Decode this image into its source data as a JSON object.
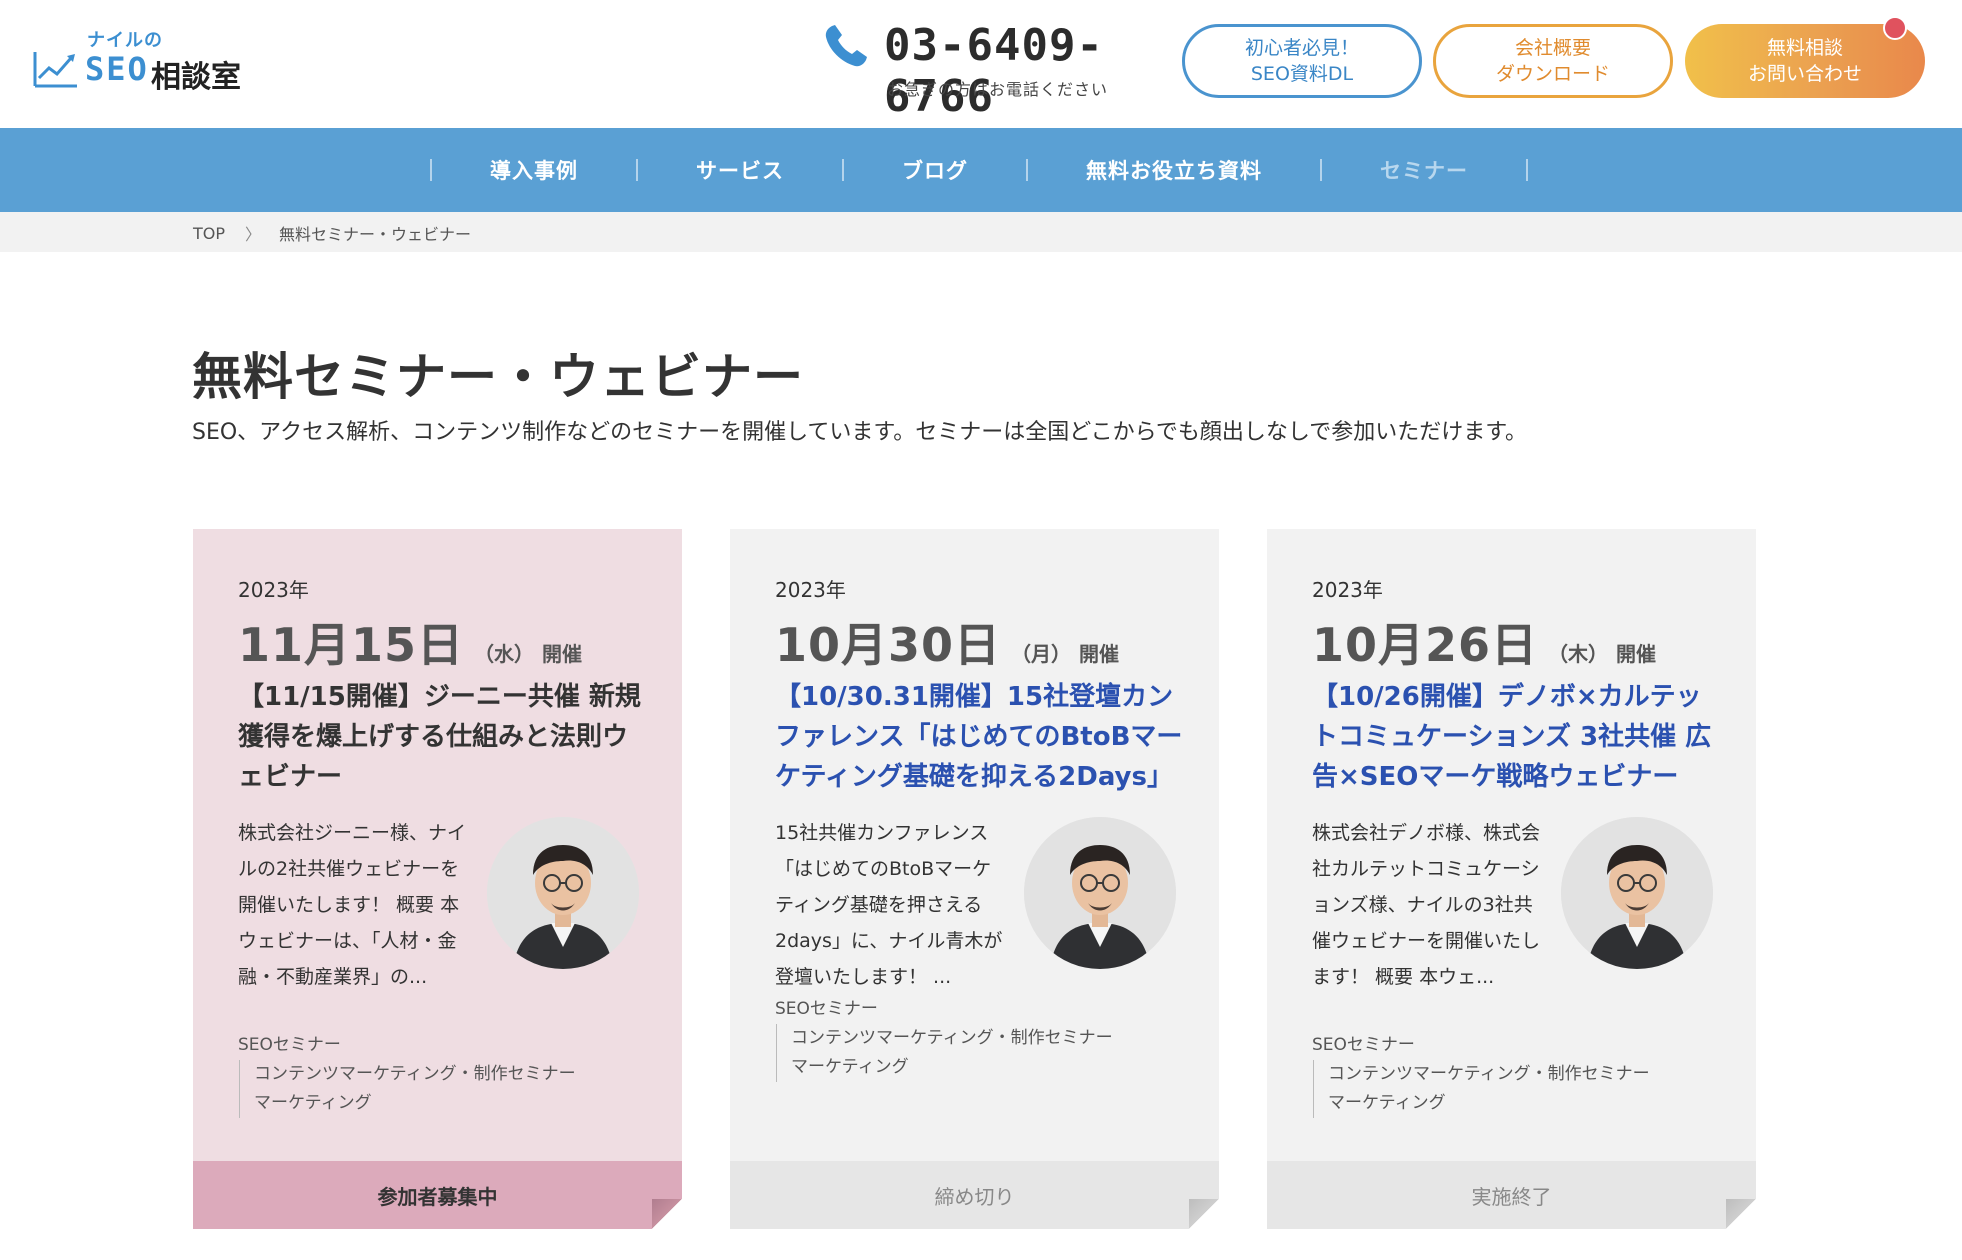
{
  "header": {
    "logo_small": "ナイルの",
    "logo_seo": "SEO",
    "logo_jp": "相談室",
    "phone_number": "03-6409-6766",
    "phone_note": "お急ぎの方はお電話ください",
    "buttons": [
      {
        "line1": "初心者必見！",
        "line2": "SEO資料DL"
      },
      {
        "line1": "会社概要",
        "line2": "ダウンロード"
      },
      {
        "line1": "無料相談",
        "line2": "お問い合わせ"
      }
    ],
    "colors": {
      "brand_blue": "#3c8fd1",
      "nav_blue": "#5aa0d4",
      "orange": "#e9a43d",
      "notification": "#e0525e"
    }
  },
  "nav": {
    "items": [
      {
        "label": "導入事例"
      },
      {
        "label": "サービス"
      },
      {
        "label": "ブログ"
      },
      {
        "label": "無料お役立ち資料"
      },
      {
        "label": "セミナー"
      }
    ]
  },
  "breadcrumb": {
    "home": "TOP",
    "separator": "〉",
    "current": "無料セミナー・ウェビナー"
  },
  "page": {
    "title": "無料セミナー・ウェビナー",
    "description": "SEO、アクセス解析、コンテンツ制作などのセミナーを開催しています。セミナーは全国どこからでも顔出しなしで参加いただけます。"
  },
  "cards": [
    {
      "year": "2023年",
      "date": "11月15日",
      "weekday": "（水）",
      "held": "開催",
      "title": "【11/15開催】ジーニー共催 新規獲得を爆上げする仕組みと法則ウェビナー",
      "excerpt": "株式会社ジーニー様、ナイルの2社共催ウェビナーを開催いたします！ 概要 本ウェビナーは、「人材・金融・不動産業界」の...",
      "tag_main": "SEOセミナー",
      "tag_sub1": "コンテンツマーケティング・制作セミナー",
      "tag_sub2": "マーケティング",
      "status": "参加者募集中"
    },
    {
      "year": "2023年",
      "date": "10月30日",
      "weekday": "（月）",
      "held": "開催",
      "title": "【10/30.31開催】15社登壇カンファレンス「はじめてのBtoBマーケティング基礎を抑える2Days」",
      "excerpt": "15社共催カンファレンス「はじめてのBtoBマーケティング基礎を押さえる2days」に、ナイル青木が登壇いたします！ ...",
      "tag_main": "SEOセミナー",
      "tag_sub1": "コンテンツマーケティング・制作セミナー",
      "tag_sub2": "マーケティング",
      "status": "締め切り"
    },
    {
      "year": "2023年",
      "date": "10月26日",
      "weekday": "（木）",
      "held": "開催",
      "title": "【10/26開催】デノボ×カルテットコミュケーションズ 3社共催 広告×SEOマーケ戦略ウェビナー",
      "excerpt": "株式会社デノボ様、株式会社カルテットコミュケーションズ様、ナイルの3社共催ウェビナーを開催いたします！ 概要 本ウェ...",
      "tag_main": "SEOセミナー",
      "tag_sub1": "コンテンツマーケティング・制作セミナー",
      "tag_sub2": "マーケティング",
      "status": "実施終了"
    }
  ]
}
